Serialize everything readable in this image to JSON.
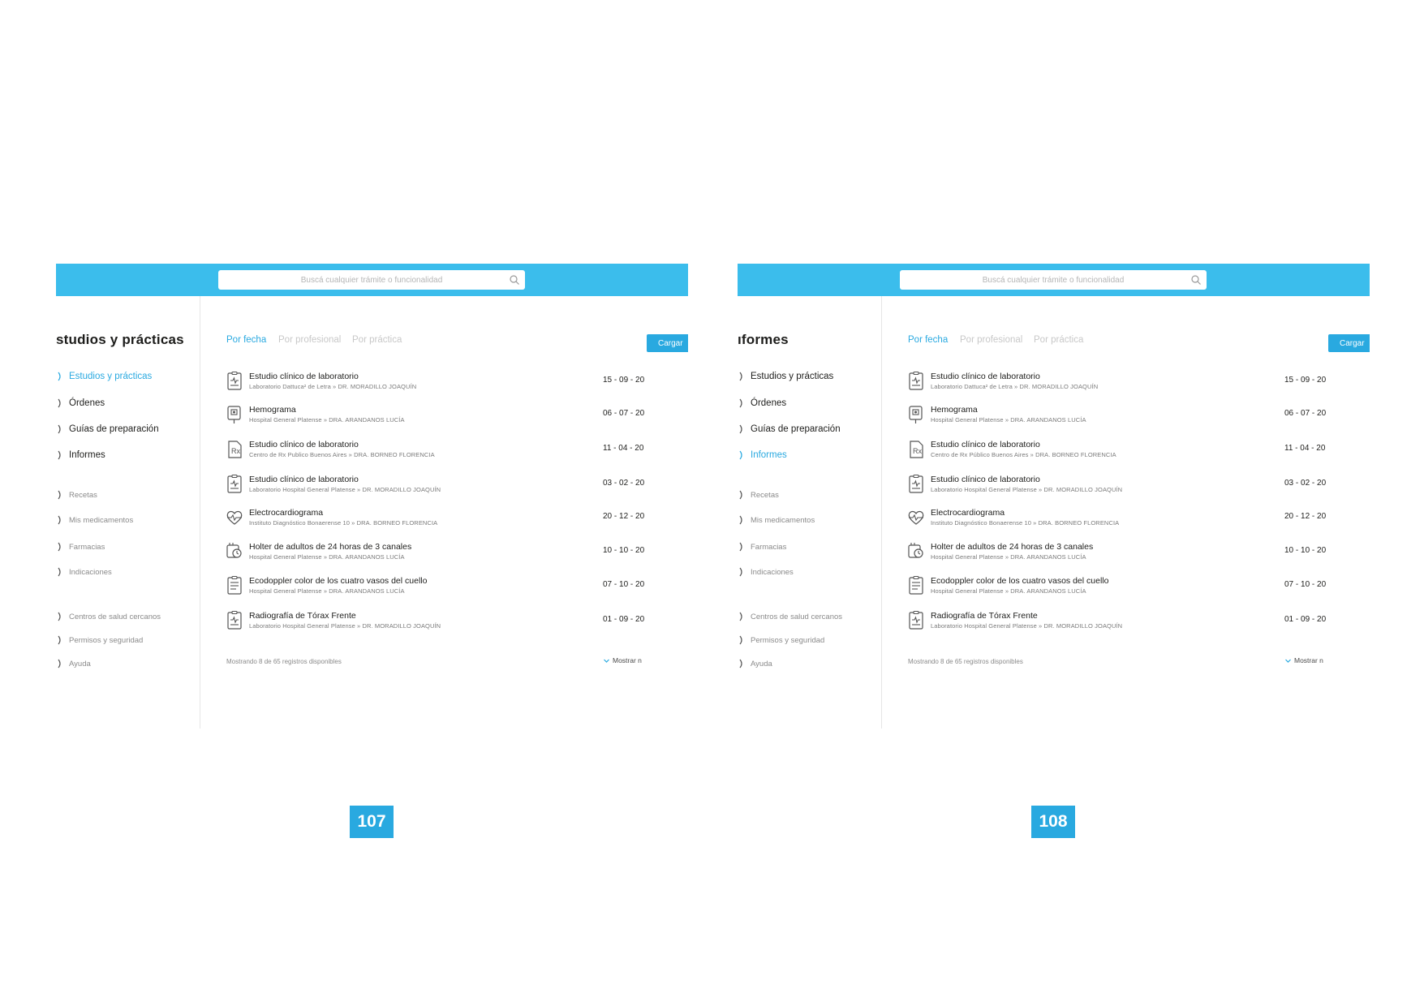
{
  "colors": {
    "brand": "#3bbdec",
    "accent": "#29a9e0",
    "text": "#1d1d1b",
    "muted": "#8a8a8a"
  },
  "search": {
    "placeholder": "Buscá cualquier trámite o funcionalidad"
  },
  "tabs": [
    "Por fecha",
    "Por profesional",
    "Por práctica"
  ],
  "cargar_label": "Cargar",
  "primary_nav": [
    "Estudios y prácticas",
    "Órdenes",
    "Guías de preparación",
    "Informes"
  ],
  "secondary_nav": [
    "Recetas",
    "Mis medicamentos",
    "Farmacias",
    "Indicaciones"
  ],
  "tertiary_nav": [
    "Centros de salud cercanos",
    "Permisos y seguridad",
    "Ayuda"
  ],
  "pages": [
    {
      "title": "studios y prácticas",
      "active_nav": "Estudios y prácticas",
      "page_number": "107",
      "rows": [
        {
          "icon": "clipboard-chart-icon",
          "title": "Estudio clínico de laboratorio",
          "sub": "Laboratorio Dattuca² de Letra » DR. MORADILLO JOAQUÍN",
          "date": "15 - 09 - 20"
        },
        {
          "icon": "blood-bag-icon",
          "title": "Hemograma",
          "sub": "Hospital General Platense » DRA. ARANDANOS LUCÍA",
          "date": "06 - 07 - 20"
        },
        {
          "icon": "prescription-icon",
          "title": "Estudio clínico de laboratorio",
          "sub": "Centro de Rx Publico Buenos Aires » DRA. BORNEO FLORENCIA",
          "date": "11 - 04 - 20"
        },
        {
          "icon": "clipboard-chart-icon",
          "title": "Estudio clínico de laboratorio",
          "sub": "Laboratorio Hospital General Platense » DR. MORADILLO JOAQUÍN",
          "date": "03 - 02 - 20"
        },
        {
          "icon": "heart-pulse-icon",
          "title": "Electrocardiograma",
          "sub": "Instituto Diagnóstico Bonaerense 10 » DRA. BORNEO FLORENCIA",
          "date": "20 - 12 - 20"
        },
        {
          "icon": "holter-monitor-icon",
          "title": "Holter de adultos de 24 horas de 3 canales",
          "sub": "Hospital General Platense » DRA. ARANDANOS LUCÍA",
          "date": "10 - 10 - 20"
        },
        {
          "icon": "clipboard-doc-icon",
          "title": "Ecodoppler color de los cuatro vasos del cuello",
          "sub": "Hospital General Platense » DRA. ARANDANOS LUCÍA",
          "date": "07 - 10 - 20"
        },
        {
          "icon": "clipboard-chart-icon",
          "title": "Radiografía de Tórax Frente",
          "sub": "Laboratorio Hospital General Platense » DR. MORADILLO JOAQUÍN",
          "date": "01 - 09 - 20"
        }
      ],
      "footer_note": "Mostrando 8 de 65 registros disponibles",
      "mostrar": "Mostrar n"
    },
    {
      "title": "ıformes",
      "active_nav": "Informes",
      "page_number": "108",
      "rows": [
        {
          "icon": "clipboard-chart-icon",
          "title": "Estudio clínico de laboratorio",
          "sub": "Laboratorio Dattuca² de Letra » DR. MORADILLO JOAQUÍN",
          "date": "15 - 09 - 20"
        },
        {
          "icon": "blood-bag-icon",
          "title": "Hemograma",
          "sub": "Hospital General Platense » DRA. ARANDANOS LUCÍA",
          "date": "06 - 07 - 20"
        },
        {
          "icon": "prescription-icon",
          "title": "Estudio clínico de laboratorio",
          "sub": "Centro de Rx Público Buenos Aires » DRA. BORNEO FLORENCIA",
          "date": "11 - 04 - 20"
        },
        {
          "icon": "clipboard-chart-icon",
          "title": "Estudio clínico de laboratorio",
          "sub": "Laboratorio Hospital General Platense » DR. MORADILLO JOAQUÍN",
          "date": "03 - 02 - 20"
        },
        {
          "icon": "heart-pulse-icon",
          "title": "Electrocardiograma",
          "sub": "Instituto Diagnóstico Bonaerense 10 » DRA. BORNEO FLORENCIA",
          "date": "20 - 12 - 20"
        },
        {
          "icon": "holter-monitor-icon",
          "title": "Holter de adultos de 24 horas de 3 canales",
          "sub": "Hospital General Platense » DRA. ARANDANOS LUCÍA",
          "date": "10 - 10 - 20"
        },
        {
          "icon": "clipboard-doc-icon",
          "title": "Ecodoppler color de los cuatro vasos del cuello",
          "sub": "Hospital General Platense » DRA. ARANDANOS LUCÍA",
          "date": "07 - 10 - 20"
        },
        {
          "icon": "clipboard-chart-icon",
          "title": "Radiografía de Tórax Frente",
          "sub": "Laboratorio Hospital General Platense » DR. MORADILLO JOAQUÍN",
          "date": "01 - 09 - 20"
        }
      ],
      "footer_note": "Mostrando 8 de 65 registros disponibles",
      "mostrar": "Mostrar n"
    }
  ]
}
